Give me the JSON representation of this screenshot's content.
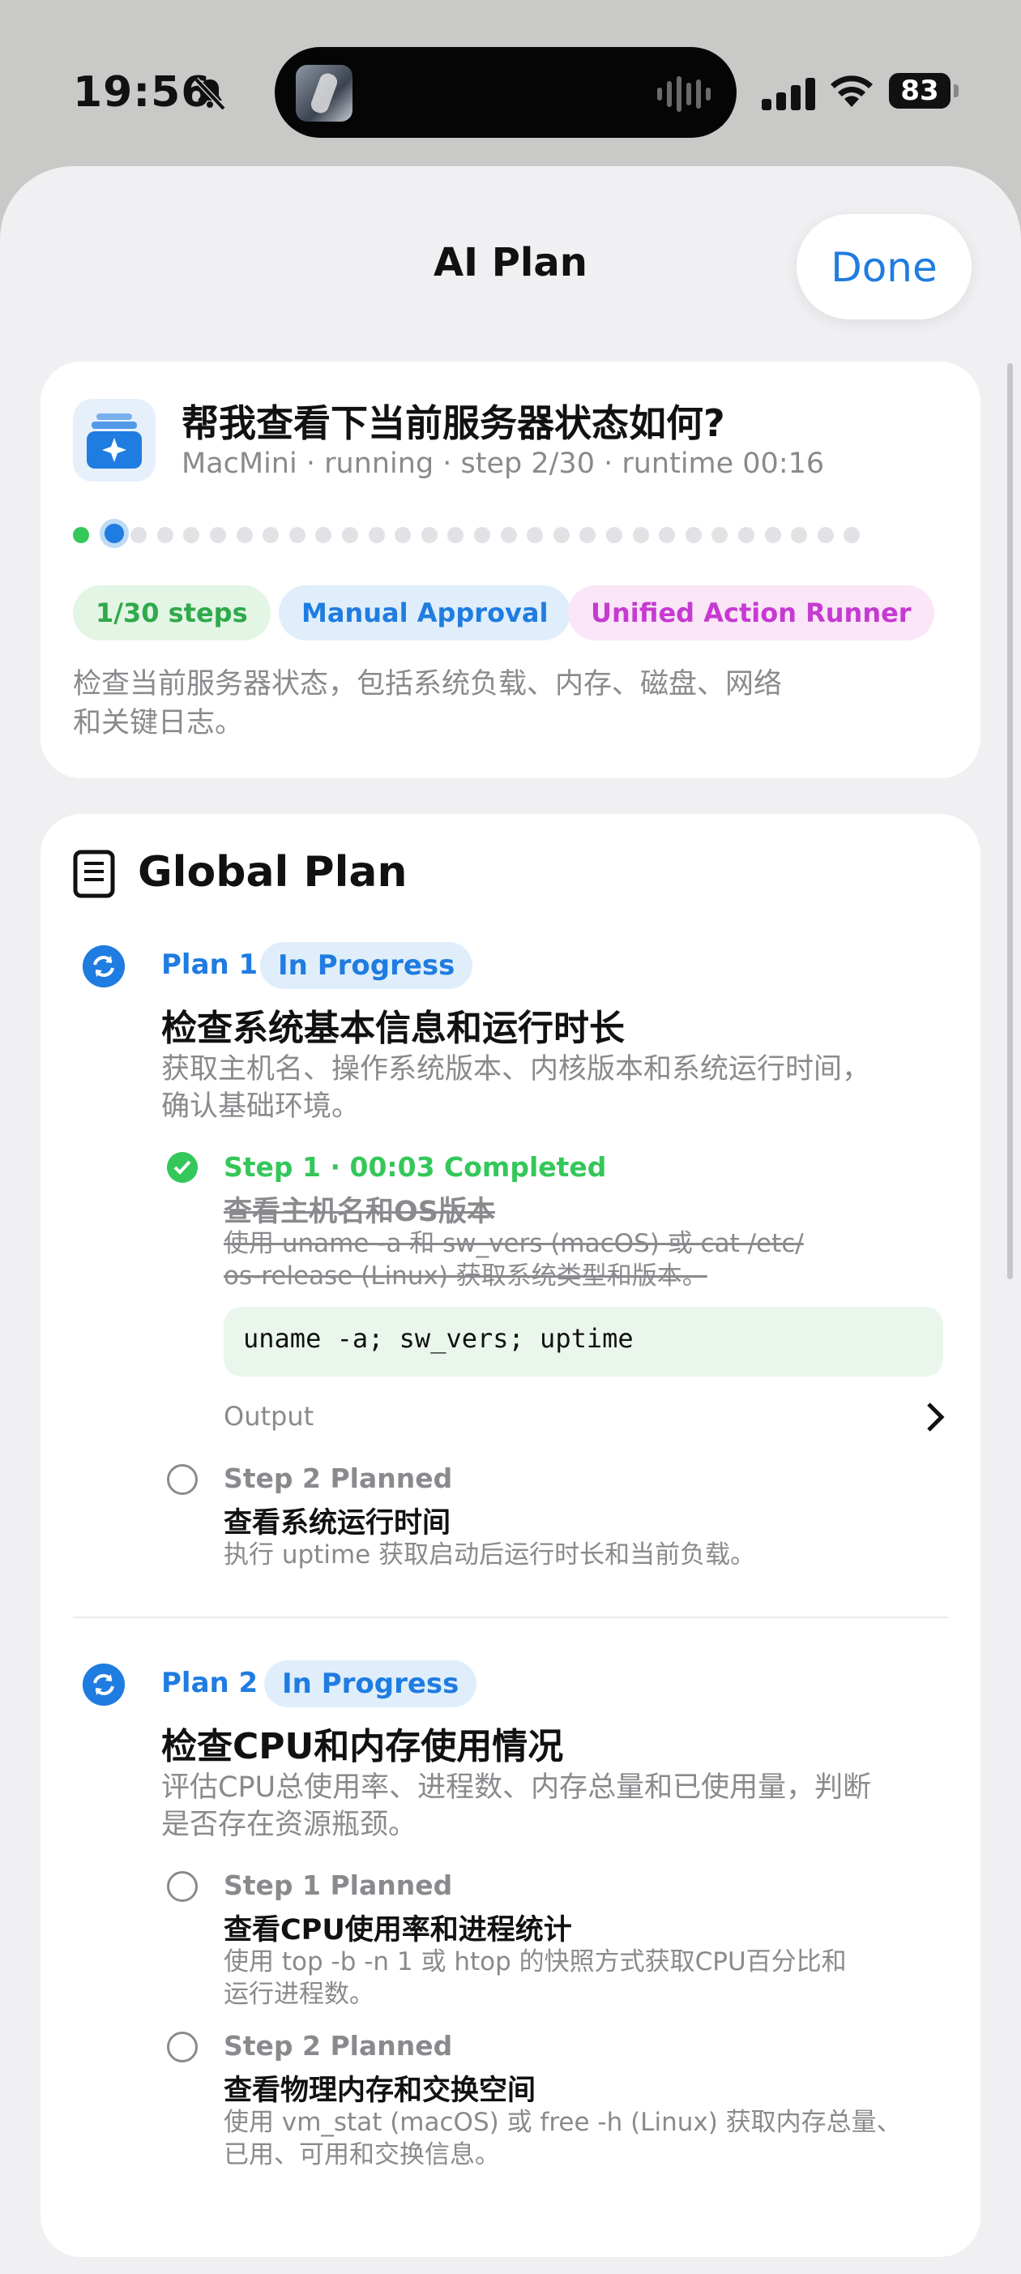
{
  "status_bar": {
    "time": "19:56",
    "battery": "83"
  },
  "sheet": {
    "title": "AI Plan",
    "done_label": "Done"
  },
  "summary": {
    "question": "帮我查看下当前服务器状态如何?",
    "meta": "MacMini · running · step 2/30 · runtime 00:16",
    "progress": {
      "total_steps": 30,
      "completed": 1,
      "current": 2
    },
    "badges": {
      "steps": "1/30 steps",
      "approval": "Manual Approval",
      "runner": "Unified Action Runner"
    },
    "description_line1": "检查当前服务器状态，包括系统负载、内存、磁盘、网络",
    "description_line2": "和关键日志。"
  },
  "global_plan": {
    "title": "Global Plan",
    "plans": [
      {
        "label": "Plan 1",
        "status": "In Progress",
        "title": "检查系统基本信息和运行时长",
        "desc_line1": "获取主机名、操作系统版本、内核版本和系统运行时间，",
        "desc_line2": "确认基础环境。",
        "steps": [
          {
            "head": "Step 1 · 00:03 Completed",
            "title": "查看主机名和OS版本",
            "desc_line1": "使用 uname -a 和 sw_vers (macOS) 或 cat /etc/",
            "desc_line2": "os-release (Linux) 获取系统类型和版本。",
            "command": "uname -a; sw_vers; uptime",
            "output_label": "Output"
          },
          {
            "head": "Step 2 Planned",
            "title": "查看系统运行时间",
            "desc_line1": "执行 uptime 获取启动后运行时长和当前负载。"
          }
        ]
      },
      {
        "label": "Plan 2",
        "status": "In Progress",
        "title": "检查CPU和内存使用情况",
        "desc_line1": "评估CPU总使用率、进程数、内存总量和已使用量，判断",
        "desc_line2": "是否存在资源瓶颈。",
        "steps": [
          {
            "head": "Step 1 Planned",
            "title": "查看CPU使用率和进程统计",
            "desc_line1": "使用 top -b -n 1 或 htop 的快照方式获取CPU百分比和",
            "desc_line2": "运行进程数。"
          },
          {
            "head": "Step 2 Planned",
            "title": "查看物理内存和交换空间",
            "desc_line1": "使用 vm_stat (macOS) 或 free -h (Linux) 获取内存总量、",
            "desc_line2": "已用、可用和交换信息。"
          }
        ]
      }
    ]
  },
  "colors": {
    "accent": "#1f7ce0",
    "success": "#34c759",
    "runner": "#c63ad2"
  }
}
